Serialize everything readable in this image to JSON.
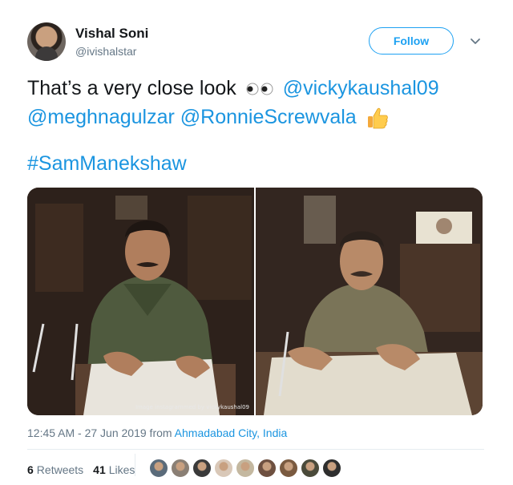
{
  "author": {
    "name": "Vishal Soni",
    "handle": "@ivishalstar",
    "follow_label": "Follow"
  },
  "tweet": {
    "text_part1": "That’s a very close look",
    "mention1": "@vickykaushal09",
    "mention2": "@meghnagulzar",
    "mention3": "@RonnieScrewvala",
    "hashtag": "#SamManekshaw",
    "emoji_icons": [
      "eyes-icon",
      "thumbs-up-icon"
    ]
  },
  "media": {
    "watermark": "Image instagrammed by vickykaushal09"
  },
  "meta": {
    "timestamp": "12:45 AM - 27 Jun 2019 from ",
    "place": "Ahmadabad City, India"
  },
  "stats": {
    "retweets_count": "6",
    "retweets_label": "Retweets",
    "likes_count": "41",
    "likes_label": "Likes"
  },
  "likers": [
    {
      "color": "#5a6b7a"
    },
    {
      "color": "#8a7f74"
    },
    {
      "color": "#3a3a3a"
    },
    {
      "color": "#d9c8b8"
    },
    {
      "color": "#c4b8a0"
    },
    {
      "color": "#6e5040"
    },
    {
      "color": "#7a5a40"
    },
    {
      "color": "#4a4a3a"
    },
    {
      "color": "#2e2e2e"
    }
  ],
  "colors": {
    "accent": "#1da1f2",
    "link": "#1b95e0",
    "muted": "#657786"
  }
}
